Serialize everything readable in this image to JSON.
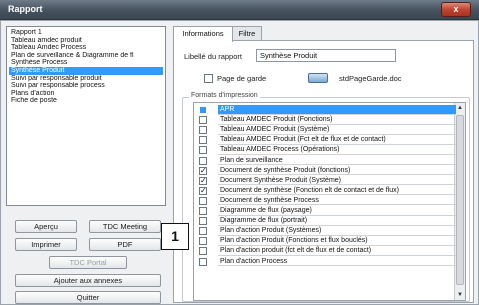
{
  "window": {
    "title": "Rapport",
    "close_label": "x"
  },
  "sidebar": {
    "items": [
      {
        "label": "Rapport 1",
        "selected": false
      },
      {
        "label": "Tableau amdec produit",
        "selected": false
      },
      {
        "label": "Tableau Amdec Process",
        "selected": false
      },
      {
        "label": "Plan de surveillance & Diagramme de fl",
        "selected": false
      },
      {
        "label": "Synthèse Process",
        "selected": false
      },
      {
        "label": "Synthèse Produit",
        "selected": true
      },
      {
        "label": "Suivi par responsable produit",
        "selected": false
      },
      {
        "label": "Suivi par responsable process",
        "selected": false
      },
      {
        "label": "Plans d'action",
        "selected": false
      },
      {
        "label": "Fiche de poste",
        "selected": false
      }
    ]
  },
  "buttons": {
    "apercu": "Aperçu",
    "tdc_meeting": "TDC Meeting",
    "imprimer": "Imprimer",
    "pdf": "PDF",
    "tdc_portal": "TDC Portal",
    "ajouter": "Ajouter aux annexes",
    "quitter": "Quitter"
  },
  "tabs": [
    {
      "label": "Informations",
      "active": true
    },
    {
      "label": "Filtre",
      "active": false
    }
  ],
  "info": {
    "libelle_label": "Libellé du rapport",
    "libelle_value": "Synthèse Produit",
    "page_garde_label": "Page de garde",
    "page_garde_checked": false,
    "page_garde_file": "stdPageGarde.doc",
    "formats_legend": "Formats d'impression"
  },
  "formats": [
    {
      "label": "APR",
      "checked": false,
      "selected": true
    },
    {
      "label": "Tableau AMDEC Produit (Fonctions)",
      "checked": false,
      "selected": false
    },
    {
      "label": "Tableau AMDEC Produit (Système)",
      "checked": false,
      "selected": false
    },
    {
      "label": "Tableau AMDEC Produit (Fct elt de flux et de contact)",
      "checked": false,
      "selected": false
    },
    {
      "label": "Tableau AMDEC Process (Opérations)",
      "checked": false,
      "selected": false
    },
    {
      "label": "Plan de surveillance",
      "checked": false,
      "selected": false
    },
    {
      "label": "Document de synthèse Produit (fonctions)",
      "checked": true,
      "selected": false
    },
    {
      "label": "Document Synthèse Produit (Système)",
      "checked": true,
      "selected": false
    },
    {
      "label": "Document de synthèse (Fonction elt de contact et de flux)",
      "checked": true,
      "selected": false
    },
    {
      "label": "Document de synthèse Process",
      "checked": false,
      "selected": false
    },
    {
      "label": "Diagramme de flux (paysage)",
      "checked": false,
      "selected": false
    },
    {
      "label": "Diagramme de flux (portrait)",
      "checked": false,
      "selected": false
    },
    {
      "label": "Plan d'action Produit (Systèmes)",
      "checked": false,
      "selected": false
    },
    {
      "label": "Plan d'action Produit (Fonctions et flux bouclés)",
      "checked": false,
      "selected": false
    },
    {
      "label": "Plan d'action produit (fct elt de flux et de contact)",
      "checked": false,
      "selected": false
    },
    {
      "label": "Plan d'action Process",
      "checked": false,
      "selected": false
    }
  ],
  "callout": "1",
  "colors": {
    "selection": "#3399ff",
    "titlebar": "#46525e"
  }
}
